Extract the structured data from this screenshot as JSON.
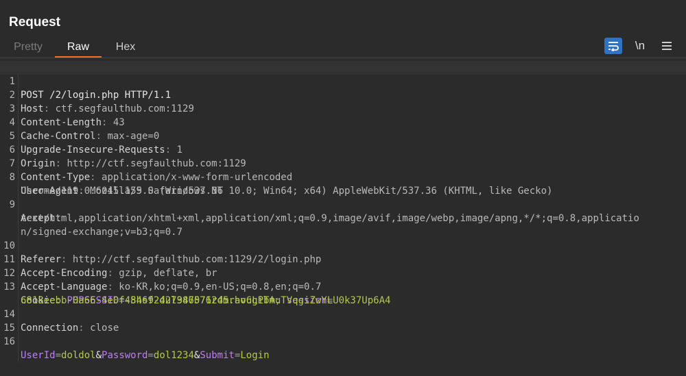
{
  "panel": {
    "title": "Request"
  },
  "tabs": [
    {
      "label": "Pretty"
    },
    {
      "label": "Raw"
    },
    {
      "label": "Hex"
    }
  ],
  "toolbar": {
    "newline_label": "\\n"
  },
  "colors": {
    "accent": "#e8702a",
    "active_button": "#2f73c2",
    "cookie_name": "#bd7ff2",
    "cookie_value": "#b5c84e"
  },
  "lines": [
    {
      "num": "1",
      "text": "POST /2/login.php HTTP/1.1"
    },
    {
      "num": "2",
      "key": "Host",
      "value": "ctf.segfaulthub.com:1129"
    },
    {
      "num": "3",
      "key": "Content-Length",
      "value": "43"
    },
    {
      "num": "4",
      "key": "Cache-Control",
      "value": "max-age=0"
    },
    {
      "num": "5",
      "key": "Upgrade-Insecure-Requests",
      "value": "1"
    },
    {
      "num": "6",
      "key": "Origin",
      "value": "http://ctf.segfaulthub.com:1129"
    },
    {
      "num": "7",
      "key": "Content-Type",
      "value": "application/x-www-form-urlencoded"
    },
    {
      "num": "8",
      "key": "User-Agent",
      "value": "Mozilla/5.0 (Windows NT 10.0; Win64; x64) AppleWebKit/537.36 (KHTML, like Gecko)",
      "cont": "Chrome/119.0.6045.159 Safari/537.36"
    },
    {
      "num": "9",
      "key": "Accept",
      "cont": "text/html,application/xhtml+xml,application/xml;q=0.9,image/avif,image/webp,image/apng,*/*;q=0.8,applicatio",
      "cont2": "n/signed-exchange;v=b3;q=0.7"
    },
    {
      "num": "10",
      "key": "Referer",
      "value": "http://ctf.segfaulthub.com:1129/2/login.php"
    },
    {
      "num": "11",
      "key": "Accept-Encoding",
      "value": "gzip, deflate, br"
    },
    {
      "num": "12",
      "key": "Accept-Language",
      "value": "ko-KR,ko;q=0.9,en-US;q=0.8,en;q=0.7"
    },
    {
      "num": "13",
      "key": "Cookie",
      "c1_name": "PHPSESSID",
      "c1_value": "45hs924ul387071rdmravugibm",
      "c2_name": "session",
      "c2_value": "6818eebb-0a66-4e0f-846f-d27946576245.ho6LPTAuTVqgiZwYLU0k37Up6A4"
    },
    {
      "num": "14",
      "key": "Connection",
      "value": "close"
    },
    {
      "num": "15",
      "text": ""
    },
    {
      "num": "16",
      "p1_name": "UserId",
      "p1_value": "doldol",
      "p2_name": "Password",
      "p2_value": "dol1234",
      "p3_name": "Submit",
      "p3_value": "Login"
    }
  ]
}
